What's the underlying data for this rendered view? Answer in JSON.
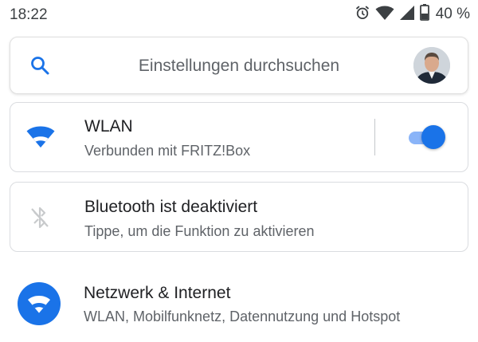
{
  "status_bar": {
    "time": "18:22",
    "battery": "40 %",
    "icons": [
      "alarm-icon",
      "wifi-signal-icon",
      "cellular-signal-icon",
      "battery-icon"
    ]
  },
  "search": {
    "placeholder": "Einstellungen durchsuchen",
    "icon": "search-icon"
  },
  "wlan_card": {
    "title": "WLAN",
    "subtitle": "Verbunden mit FRITZ!Box",
    "icon": "wifi-icon",
    "toggle_on": true
  },
  "bluetooth_card": {
    "title": "Bluetooth ist deaktiviert",
    "subtitle": "Tippe, um die Funktion zu aktivieren",
    "icon": "bluetooth-disabled-icon"
  },
  "settings_list": [
    {
      "title": "Netzwerk & Internet",
      "subtitle": "WLAN, Mobilfunknetz, Datennutzung und Hotspot",
      "icon": "wifi-icon"
    }
  ],
  "colors": {
    "accent": "#1a73e8",
    "toggle_track": "#8ab4f8",
    "text_primary": "#202124",
    "text_secondary": "#5f6368"
  }
}
